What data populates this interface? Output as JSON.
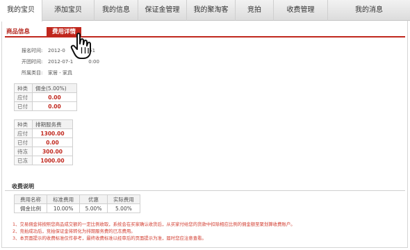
{
  "topnav": {
    "items": [
      "我的宝贝",
      "添加宝贝",
      "我的信息",
      "保证金管理",
      "我的聚淘客",
      "竞拍",
      "收费管理",
      "我的消息"
    ]
  },
  "subtabs": {
    "goods_info": "商品信息",
    "fee_detail": "费用详情"
  },
  "meta": {
    "signup_label": "报名时间:",
    "signup_value": "2012-0",
    "signup_tail": ":51",
    "open_label": "开团时间:",
    "open_value": "2012-07-1",
    "open_tail": "0:00",
    "category_label": "所属类目:",
    "category_value": "家居 - 家具"
  },
  "commission_table": {
    "header": [
      "种类",
      "佣金(5.00%)"
    ],
    "rows": [
      {
        "label": "应付",
        "value": "0.00"
      },
      {
        "label": "已付",
        "value": "0.00"
      }
    ]
  },
  "service_table": {
    "header": [
      "种类",
      "排期服务费"
    ],
    "rows": [
      {
        "label": "应付",
        "value": "1300.00"
      },
      {
        "label": "已付",
        "value": "0.00"
      },
      {
        "label": "待冻",
        "value": "300.00"
      },
      {
        "label": "已冻",
        "value": "1000.00"
      }
    ]
  },
  "fee_section": {
    "title": "收费说明",
    "header": [
      "费用名称",
      "标准费用",
      "优惠",
      "实际费用"
    ],
    "row": [
      "佣金比例",
      "10.00%",
      "5.00%",
      "5.00%"
    ]
  },
  "notes": [
    "1、交易佣金将按照您商品成交额的一定比例收取，系统会在买家确认收货后，从买家付给您的货款中扣除相应比例的佣金额至聚划算收费账户。",
    "2、竞拍成功后，竞拍保证金将转化为排期服务费的已冻费用。",
    "3、本页面提示的收费标准仅作参考，最终收费标准以经审后的页面提示为准，届时您应注意查看。"
  ],
  "colors": {
    "accent": "#c0271d",
    "nav_bg": "#dcdcdc"
  }
}
